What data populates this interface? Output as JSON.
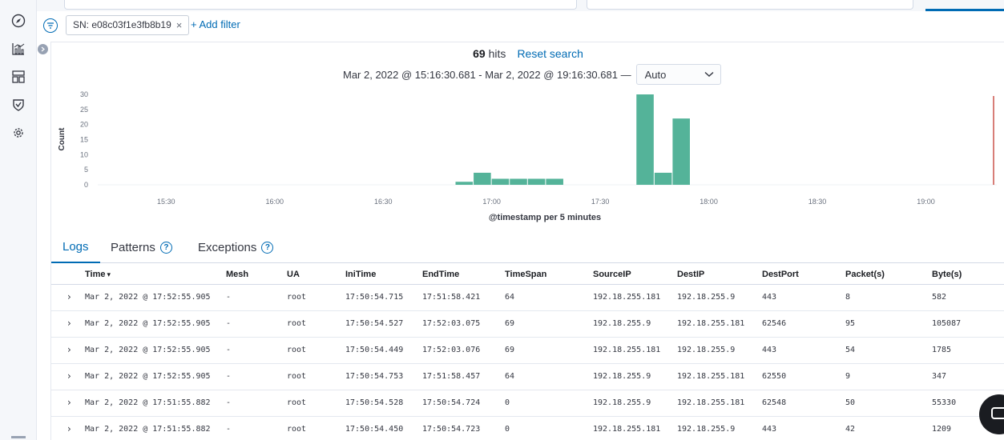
{
  "filter": {
    "pill_label": "SN: e08c03f1e3fb8b19",
    "remove_glyph": "×",
    "add_label": "+ Add filter"
  },
  "hits": {
    "count": "69",
    "label": "hits",
    "reset_label": "Reset search"
  },
  "time_range": {
    "text": "Mar 2, 2022 @ 15:16:30.681 - Mar 2, 2022 @ 19:16:30.681 —",
    "interval": "Auto"
  },
  "nav_icons": [
    "compass-icon",
    "chart-icon",
    "dashboard-icon",
    "shield-icon",
    "gear-icon"
  ],
  "colors": {
    "bar": "#54b399",
    "marker": "#bd271e",
    "accent": "#006bb4"
  },
  "chart_data": {
    "type": "bar",
    "ylabel": "Count",
    "xlabel": "@timestamp per 5 minutes",
    "ylim": [
      0,
      30
    ],
    "yticks": [
      0,
      5,
      10,
      15,
      20,
      25,
      30
    ],
    "xticks": [
      "15:30",
      "16:00",
      "16:30",
      "17:00",
      "17:30",
      "18:00",
      "18:30",
      "19:00"
    ],
    "bucket_minutes": 5,
    "start": "15:16:30",
    "end": "19:16:30",
    "bars": [
      {
        "start": "16:50",
        "value": 1
      },
      {
        "start": "16:55",
        "value": 4
      },
      {
        "start": "17:00",
        "value": 2
      },
      {
        "start": "17:05",
        "value": 2
      },
      {
        "start": "17:10",
        "value": 2
      },
      {
        "start": "17:15",
        "value": 2
      },
      {
        "start": "17:40",
        "value": 30
      },
      {
        "start": "17:45",
        "value": 4
      },
      {
        "start": "17:50",
        "value": 22
      }
    ],
    "marker": "19:16:30",
    "grid": false
  },
  "tabs": [
    {
      "label": "Logs",
      "active": true
    },
    {
      "label": "Patterns",
      "help": "?"
    },
    {
      "label": "Exceptions",
      "help": "?"
    }
  ],
  "table": {
    "headers": [
      "Time",
      "Mesh",
      "UA",
      "IniTime",
      "EndTime",
      "TimeSpan",
      "SourceIP",
      "DestIP",
      "DestPort",
      "Packet(s)",
      "Byte(s)"
    ],
    "sort_glyph": "▾",
    "rows": [
      [
        "Mar 2, 2022 @ 17:52:55.905",
        "-",
        "root",
        "17:50:54.715",
        "17:51:58.421",
        "64",
        "192.18.255.181",
        "192.18.255.9",
        "443",
        "8",
        "582"
      ],
      [
        "Mar 2, 2022 @ 17:52:55.905",
        "-",
        "root",
        "17:50:54.527",
        "17:52:03.075",
        "69",
        "192.18.255.9",
        "192.18.255.181",
        "62546",
        "95",
        "105087"
      ],
      [
        "Mar 2, 2022 @ 17:52:55.905",
        "-",
        "root",
        "17:50:54.449",
        "17:52:03.076",
        "69",
        "192.18.255.181",
        "192.18.255.9",
        "443",
        "54",
        "1785"
      ],
      [
        "Mar 2, 2022 @ 17:52:55.905",
        "-",
        "root",
        "17:50:54.753",
        "17:51:58.457",
        "64",
        "192.18.255.9",
        "192.18.255.181",
        "62550",
        "9",
        "347"
      ],
      [
        "Mar 2, 2022 @ 17:51:55.882",
        "-",
        "root",
        "17:50:54.528",
        "17:50:54.724",
        "0",
        "192.18.255.9",
        "192.18.255.181",
        "62548",
        "50",
        "55330"
      ],
      [
        "Mar 2, 2022 @ 17:51:55.882",
        "-",
        "root",
        "17:50:54.450",
        "17:50:54.723",
        "0",
        "192.18.255.181",
        "192.18.255.9",
        "443",
        "42",
        "1209"
      ]
    ]
  }
}
